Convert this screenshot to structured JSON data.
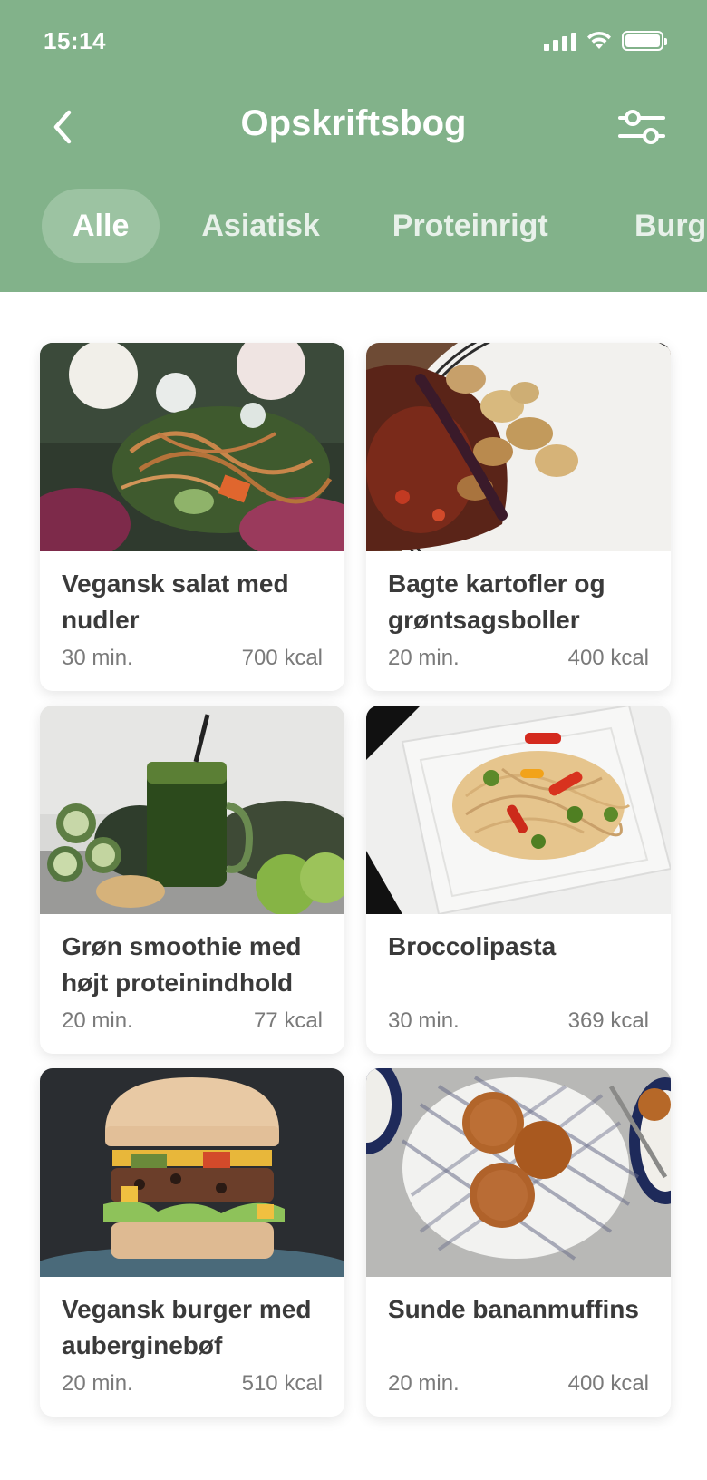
{
  "status_bar": {
    "time": "15:14"
  },
  "header": {
    "title": "Opskriftsbog"
  },
  "tabs": [
    {
      "label": "Alle",
      "active": true
    },
    {
      "label": "Asiatisk",
      "active": false
    },
    {
      "label": "Proteinrigt",
      "active": false
    },
    {
      "label": "Burg",
      "active": false
    }
  ],
  "recipes": [
    {
      "name": "Vegansk salat med nudler",
      "time": "30 min.",
      "kcal": "700 kcal"
    },
    {
      "name": "Bagte kartofler og grøntsagsboller",
      "time": "20 min.",
      "kcal": "400 kcal"
    },
    {
      "name": "Grøn smoothie med højt proteinindhold",
      "time": "20 min.",
      "kcal": "77 kcal"
    },
    {
      "name": "Broccolipasta",
      "time": "30 min.",
      "kcal": "369 kcal"
    },
    {
      "name": "Vegansk burger med auberginebøf",
      "time": "20 min.",
      "kcal": "510 kcal"
    },
    {
      "name": "Sunde bananmuffins",
      "time": "20 min.",
      "kcal": "400 kcal"
    }
  ],
  "colors": {
    "header": "#82b28a",
    "active_tab": "#9cc3a2",
    "card_text": "#3a3a3a",
    "meta_text": "#7a7a7a"
  },
  "icons": {
    "back": "chevron-left-icon",
    "filter": "sliders-icon"
  }
}
